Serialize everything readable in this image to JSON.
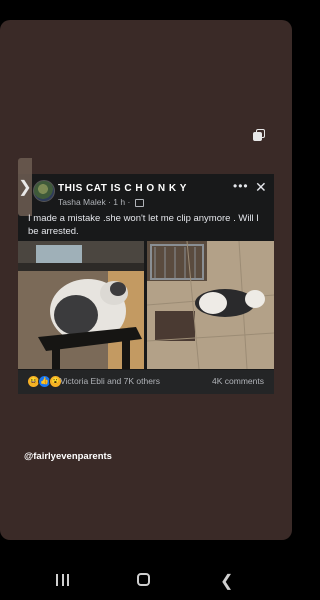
{
  "post": {
    "group_name": "THIS CAT IS C H O N K Y",
    "author": "Tasha Malek",
    "time": "1 h",
    "text": "I made a mistake .she won't let me clip anymore . Will I be arrested.",
    "reactors": "Victoria Ebli and 7K others",
    "comments": "4K comments"
  },
  "icons": {
    "reactions": [
      "haha-icon",
      "like-icon",
      "wow-icon"
    ],
    "header": [
      "more-icon",
      "close-icon"
    ],
    "audience": "globe-icon"
  },
  "watermark": "@fairlyevenparents",
  "colors": {
    "story_background": "#3a2a27",
    "post_card": "#18191a",
    "reaction_bar": "#242526"
  }
}
